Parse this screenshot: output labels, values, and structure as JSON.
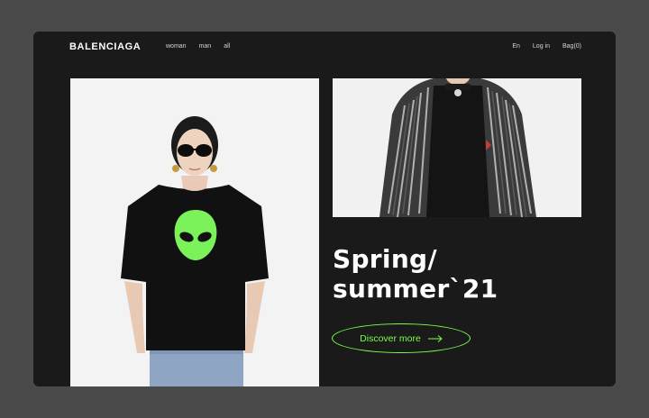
{
  "brand": {
    "name": "BALENCIAGA"
  },
  "nav": {
    "items": [
      "woman",
      "man",
      "all"
    ]
  },
  "account_nav": {
    "language": "En",
    "login": "Log in",
    "bag": "Bag(0)"
  },
  "hero": {
    "headline_line1": "Spring/",
    "headline_line2": "summer`21",
    "cta_label": "Discover more",
    "cta_icon": "arrow-right-icon"
  },
  "images": {
    "left": "model-in-black-alien-tshirt",
    "right": "model-in-black-fringe-jacket"
  },
  "colors": {
    "background": "#4a4a4a",
    "window": "#1a1a1a",
    "accent": "#7cff4a",
    "text": "#ffffff"
  }
}
